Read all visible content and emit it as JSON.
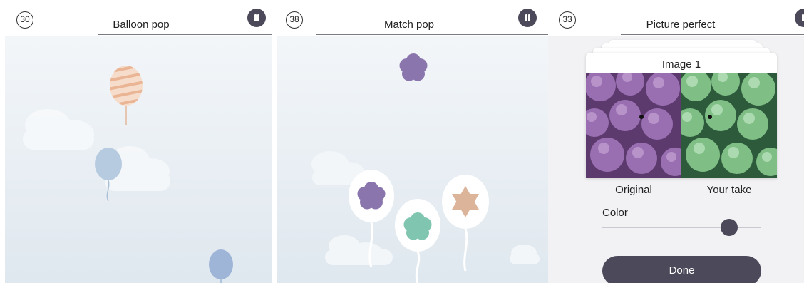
{
  "panels": [
    {
      "id": "balloon",
      "timer": "30",
      "title": "Balloon pop"
    },
    {
      "id": "match",
      "timer": "38",
      "title": "Match pop"
    },
    {
      "id": "picture",
      "timer": "33",
      "title": "Picture perfect"
    }
  ],
  "picture": {
    "card_title": "Image 1",
    "original_label": "Original",
    "your_take_label": "Your take",
    "color_label": "Color",
    "color_value": 0.8,
    "done_label": "Done"
  },
  "colors": {
    "accent": "#4c4a5a",
    "balloon_orange": "#f0c6a8",
    "balloon_blue": "#b9cde0",
    "shape_purple": "#8a76ad",
    "shape_teal": "#7fc5b0",
    "shape_tan": "#dcb49a"
  },
  "icons": [
    "pause-icon",
    "flower-shape",
    "star-shape",
    "balloon",
    "cloud"
  ]
}
